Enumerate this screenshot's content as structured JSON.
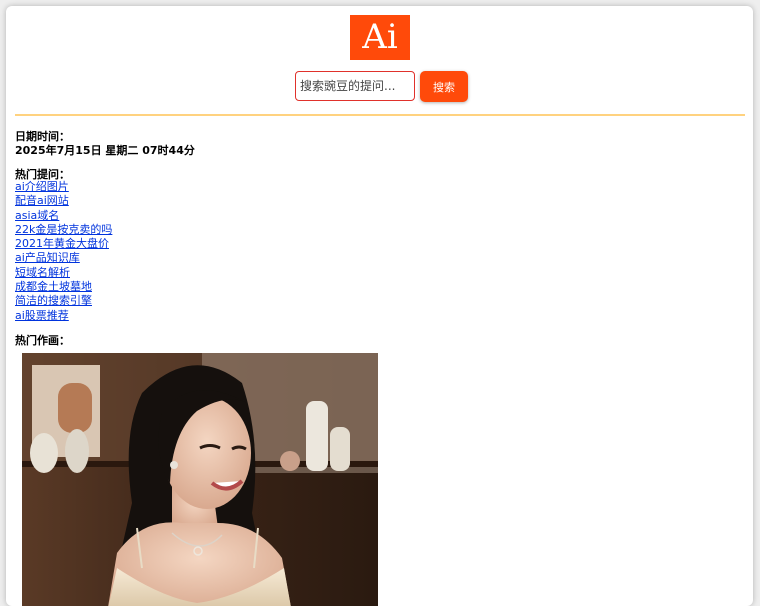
{
  "header": {
    "logo_text": "Ai",
    "search_placeholder": "搜索豌豆的提问...",
    "search_button": "搜索"
  },
  "datetime": {
    "label": "日期时间：",
    "value": "2025年7月15日 星期二 07时44分"
  },
  "hot_questions": {
    "label": "热门提问：",
    "items": [
      "ai介绍图片",
      "配音ai网站",
      "asia域名",
      "22k金是按克卖的吗",
      "2021年黄金大盘价",
      "ai产品知识库",
      "短域名解析",
      "成都金土坡墓地",
      "简洁的搜索引擎",
      "ai股票推荐"
    ]
  },
  "hot_artwork": {
    "label": "热门作画："
  },
  "colors": {
    "brand": "#ff4a0a",
    "divider": "#ffd27f",
    "link": "#0033dd",
    "input_border": "#e0312b"
  }
}
